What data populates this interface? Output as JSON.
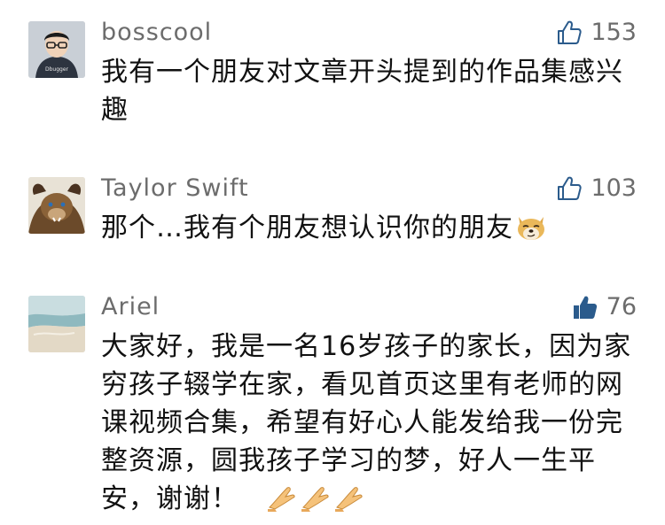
{
  "comments": [
    {
      "username": "bosscool",
      "likes": "153",
      "liked": false,
      "text": "我有一个朋友对文章开头提到的作品集感兴趣",
      "avatar_text": "Dbugger"
    },
    {
      "username": "Taylor Swift",
      "likes": "103",
      "liked": false,
      "text": "那个…我有个朋友想认识你的朋友",
      "emoji": "doge-emoji"
    },
    {
      "username": "Ariel",
      "likes": "76",
      "liked": true,
      "text": "大家好，我是一名16岁孩子的家长，因为家穷孩子辍学在家，看见首页这里有老师的网课视频合集，希望有好心人能发给我一份完整资源，圆我孩子学习的梦，好人一生平安，谢谢！",
      "emojis": [
        "folded-hands-emoji",
        "folded-hands-emoji",
        "folded-hands-emoji"
      ]
    }
  ],
  "colors": {
    "username": "#6c6c6c",
    "text": "#111111",
    "like_outline": "#2b5b8c",
    "like_filled": "#2b5b8c"
  }
}
